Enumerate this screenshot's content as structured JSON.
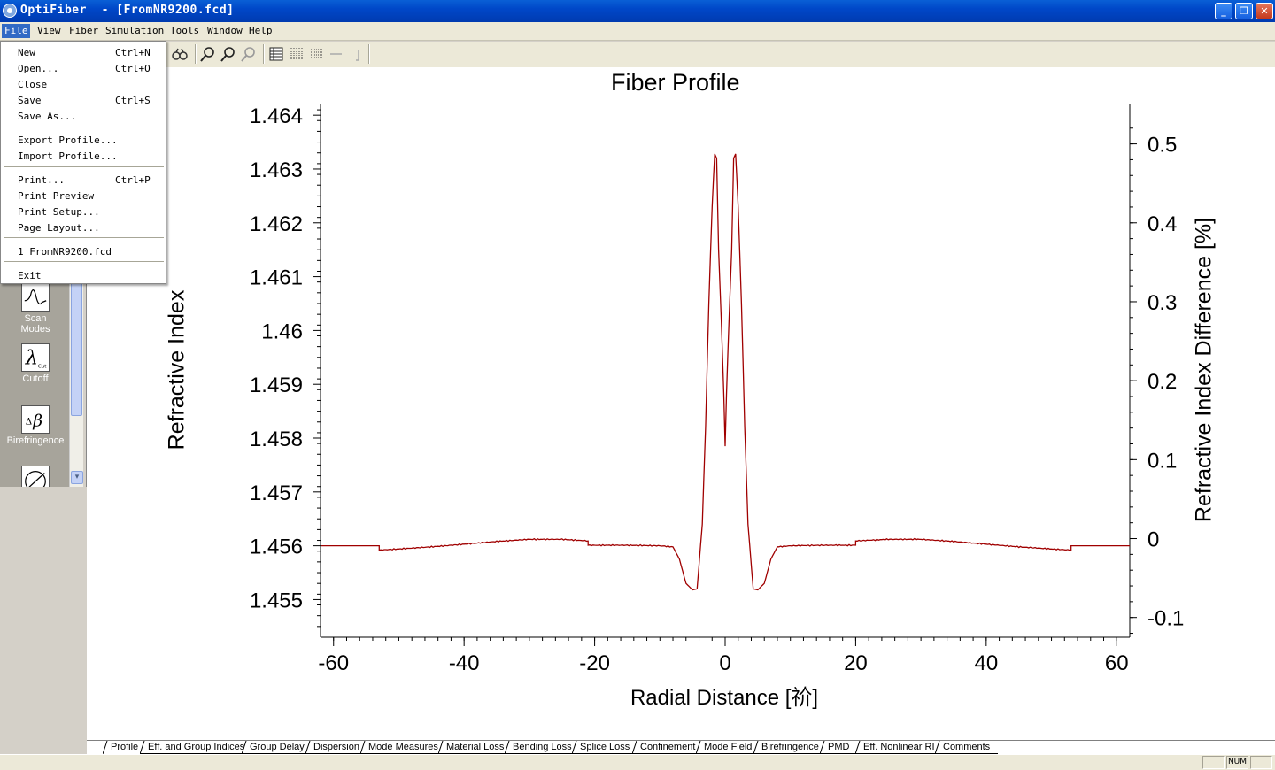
{
  "window": {
    "title": "OptiFiber  - [FromNR9200.fcd]",
    "minimize": "_",
    "restore": "❐",
    "close": "✕"
  },
  "menubar": {
    "items": [
      {
        "label": "File"
      },
      {
        "label": "View"
      },
      {
        "label": "Fiber"
      },
      {
        "label": "Simulation"
      },
      {
        "label": "Tools"
      },
      {
        "label": "Window"
      },
      {
        "label": "Help"
      }
    ]
  },
  "file_menu": {
    "items": [
      {
        "label": "New",
        "shortcut": "Ctrl+N"
      },
      {
        "label": "Open...",
        "shortcut": "Ctrl+O"
      },
      {
        "label": "Close",
        "shortcut": ""
      },
      {
        "label": "Save",
        "shortcut": "Ctrl+S"
      },
      {
        "label": "Save As...",
        "shortcut": ""
      },
      {
        "label": "Export Profile...",
        "shortcut": ""
      },
      {
        "label": "Import Profile...",
        "shortcut": ""
      },
      {
        "label": "Print...",
        "shortcut": "Ctrl+P"
      },
      {
        "label": "Print Preview",
        "shortcut": ""
      },
      {
        "label": "Print Setup...",
        "shortcut": ""
      },
      {
        "label": "Page Layout...",
        "shortcut": ""
      },
      {
        "label": "1 FromNR9200.fcd",
        "shortcut": ""
      },
      {
        "label": "Exit",
        "shortcut": ""
      }
    ]
  },
  "toolbar": {
    "icons": [
      "binoculars-icon",
      "zoom-in-icon",
      "zoom-icon",
      "zoom-out-icon",
      "table-icon",
      "columns-icon",
      "rows-icon",
      "line-icon",
      "cursor-icon"
    ]
  },
  "left_panel": {
    "tools": [
      {
        "label": "Scan\nModes",
        "icon": "scan-modes-icon"
      },
      {
        "label": "Cutoff",
        "icon": "cutoff-icon"
      },
      {
        "label": "Birefringence",
        "icon": "birefringence-icon"
      }
    ],
    "scroll_down": "▾"
  },
  "chart_data": {
    "type": "line",
    "title": "Fiber Profile",
    "xlabel": "Radial Distance [祄]",
    "ylabel": "Refractive Index",
    "ylabel_right": "Refractive Index Difference [%]",
    "xlim": [
      -62,
      62
    ],
    "ylim": [
      1.4543,
      1.4642
    ],
    "ylim_right": [
      -0.125,
      0.55
    ],
    "x_ticks": [
      "-60",
      "-40",
      "-20",
      "0",
      "20",
      "40",
      "60"
    ],
    "y_ticks": [
      "1.464",
      "1.463",
      "1.462",
      "1.461",
      "1.46",
      "1.459",
      "1.458",
      "1.457",
      "1.456",
      "1.455"
    ],
    "y_ticks_right": [
      "0.5",
      "0.4",
      "0.3",
      "0.2",
      "0.1",
      "0",
      "-0.1"
    ],
    "line_color": "#a00000",
    "series": [
      {
        "x": [
          -62,
          -53,
          -53,
          -50,
          -45,
          -40,
          -35,
          -30,
          -25,
          -21,
          -21,
          -15,
          -10,
          -8,
          -7,
          -6,
          -5,
          -4.3,
          -3.5,
          -3,
          -2.5,
          -2,
          -1.6,
          -1.3,
          -1,
          -0.6,
          -0.2,
          0,
          0.2,
          0.6,
          1,
          1.3,
          1.6,
          2,
          2.5,
          3,
          3.5,
          4.3,
          5,
          6,
          7,
          8,
          10,
          15,
          20,
          20,
          25,
          30,
          35,
          40,
          45,
          50,
          53,
          53,
          62
        ],
        "y": [
          1.456,
          1.456,
          1.45592,
          1.45594,
          1.45598,
          1.45603,
          1.45608,
          1.45612,
          1.45612,
          1.45609,
          1.45601,
          1.45601,
          1.456,
          1.45598,
          1.45575,
          1.4553,
          1.45518,
          1.4552,
          1.4564,
          1.4582,
          1.4605,
          1.4623,
          1.46328,
          1.4632,
          1.4615,
          1.4602,
          1.4588,
          1.45785,
          1.4588,
          1.4602,
          1.4615,
          1.4632,
          1.46328,
          1.4623,
          1.4605,
          1.4582,
          1.4564,
          1.4552,
          1.45518,
          1.4553,
          1.45575,
          1.45598,
          1.456,
          1.45601,
          1.45601,
          1.45609,
          1.45612,
          1.45612,
          1.45608,
          1.45603,
          1.45598,
          1.45594,
          1.45592,
          1.456,
          1.456
        ]
      }
    ],
    "grid": false
  },
  "tabs": [
    {
      "label": "Profile",
      "active": true
    },
    {
      "label": "Eff. and Group Indices"
    },
    {
      "label": "Group Delay"
    },
    {
      "label": "Dispersion"
    },
    {
      "label": "Mode Measures"
    },
    {
      "label": "Material Loss"
    },
    {
      "label": "Bending Loss"
    },
    {
      "label": "Splice Loss"
    },
    {
      "label": "Confinement"
    },
    {
      "label": "Mode Field"
    },
    {
      "label": "Birefringence"
    },
    {
      "label": "PMD"
    },
    {
      "label": "Eff. Nonlinear RI"
    },
    {
      "label": "Comments"
    }
  ],
  "statusbar": {
    "num": "NUM"
  }
}
